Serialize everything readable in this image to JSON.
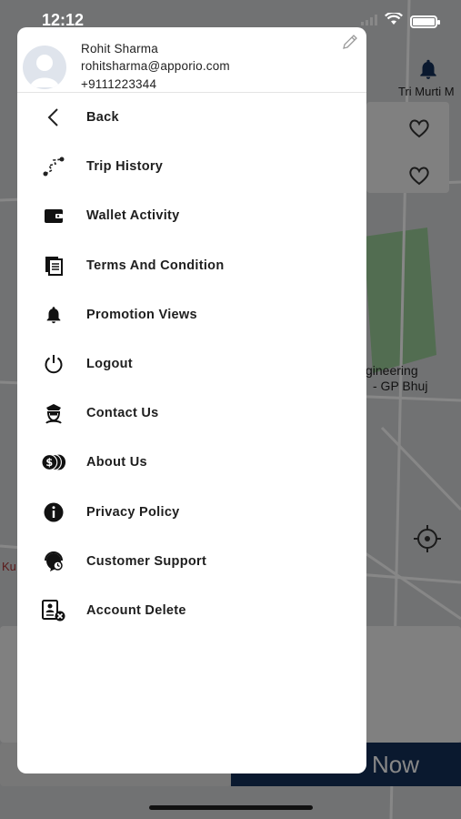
{
  "status_bar": {
    "time": "12:12"
  },
  "profile": {
    "name": "Rohit Sharma",
    "email": "rohitsharma@apporio.com",
    "phone": "+9111223344"
  },
  "menu": {
    "items": [
      {
        "label": "Back",
        "icon": "chevron-left-icon"
      },
      {
        "label": "Trip History",
        "icon": "route-icon"
      },
      {
        "label": "Wallet Activity",
        "icon": "wallet-icon"
      },
      {
        "label": "Terms And Condition",
        "icon": "documents-icon"
      },
      {
        "label": "Promotion Views",
        "icon": "bell-icon"
      },
      {
        "label": "Logout",
        "icon": "power-icon"
      },
      {
        "label": "Contact Us",
        "icon": "officer-icon"
      },
      {
        "label": "About Us",
        "icon": "coins-icon"
      },
      {
        "label": "Privacy Policy",
        "icon": "info-icon"
      },
      {
        "label": "Customer Support",
        "icon": "support-icon"
      },
      {
        "label": "Account Delete",
        "icon": "account-delete-icon"
      }
    ]
  },
  "background": {
    "map_labels": [
      "Tri Murti M",
      "gineering",
      "- GP Bhuj",
      "Ku"
    ],
    "action_button": "Now"
  },
  "colors": {
    "accent": "#14305a",
    "overlay": "rgba(0,0,0,0.47)",
    "drawer_bg": "#ffffff",
    "text": "#1e1e1e"
  }
}
